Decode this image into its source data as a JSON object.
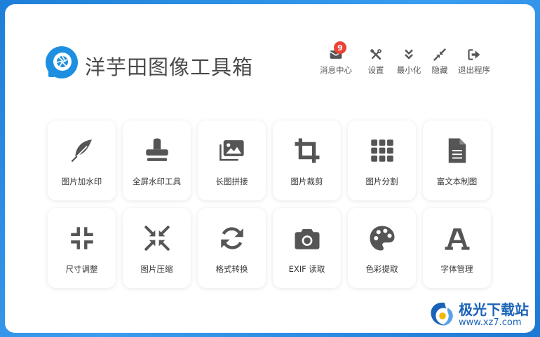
{
  "app": {
    "title": "洋芋田图像工具箱",
    "logo_icon": "camera-aperture-logo",
    "accent_color": "#1e8fe0"
  },
  "toolbar": [
    {
      "label": "消息中心",
      "icon": "envelope-icon",
      "badge": "9"
    },
    {
      "label": "设置",
      "icon": "tools-icon"
    },
    {
      "label": "最小化",
      "icon": "double-chevron-down-icon"
    },
    {
      "label": "隐藏",
      "icon": "compress-arrows-icon"
    },
    {
      "label": "退出程序",
      "icon": "sign-out-icon"
    }
  ],
  "tools": [
    {
      "label": "图片加水印",
      "icon": "feather-icon"
    },
    {
      "label": "全屏水印工具",
      "icon": "stamp-icon"
    },
    {
      "label": "长图拼接",
      "icon": "images-icon"
    },
    {
      "label": "图片裁剪",
      "icon": "crop-icon"
    },
    {
      "label": "图片分割",
      "icon": "grid-icon"
    },
    {
      "label": "富文本制图",
      "icon": "document-icon"
    },
    {
      "label": "尺寸调整",
      "icon": "compress-icon"
    },
    {
      "label": "图片压缩",
      "icon": "compress-arrows-icon"
    },
    {
      "label": "格式转换",
      "icon": "sync-icon"
    },
    {
      "label": "EXIF 读取",
      "icon": "camera-icon"
    },
    {
      "label": "色彩提取",
      "icon": "palette-icon"
    },
    {
      "label": "字体管理",
      "icon": "font-icon"
    }
  ],
  "watermark": {
    "title": "极光下载站",
    "url": "www.xz7.com"
  },
  "colors": {
    "icon": "#555555",
    "badge": "#ea4335",
    "watermark": "#1b63b8",
    "background": "#2b8ae6"
  }
}
